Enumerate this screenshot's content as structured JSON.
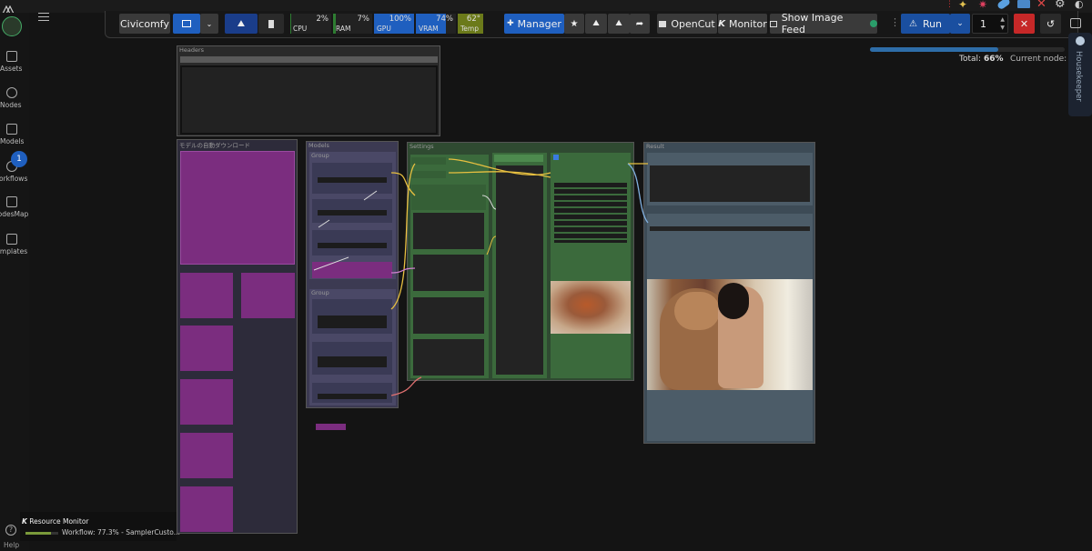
{
  "topbar": {
    "workspace_label": "Civicomfy",
    "meters": [
      {
        "name": "CPU",
        "value": "2%",
        "fill": 0.02,
        "color": "#2e7d32"
      },
      {
        "name": "RAM",
        "value": "7%",
        "fill": 0.07,
        "color": "#2e7d32"
      },
      {
        "name": "GPU",
        "value": "100%",
        "fill": 1.0,
        "color": "#1f5fbf"
      },
      {
        "name": "VRAM",
        "value": "74%",
        "fill": 0.74,
        "color": "#1f5fbf"
      },
      {
        "name": "Temp",
        "value": "62°",
        "fill": 1.0,
        "color": "#6b7a1a"
      }
    ],
    "manager_label": "Manager",
    "opencut_label": "OpenCut",
    "monitor_label": "Monitor",
    "image_feed_label": "Show Image Feed",
    "run_label": "Run",
    "run_count": "1"
  },
  "progress": {
    "total_label": "Total:",
    "total_value": "66%",
    "total_fraction": 0.66,
    "current_node_label": "Current node: –"
  },
  "sidebar": {
    "items": [
      {
        "label": "Assets"
      },
      {
        "label": "Nodes"
      },
      {
        "label": "Models"
      },
      {
        "label": "Workflows"
      },
      {
        "label": "NodesMap"
      },
      {
        "label": "Templates"
      }
    ],
    "workflows_badge": "1",
    "help_label": "Help"
  },
  "canvas": {
    "groups": {
      "headers": "Headers",
      "auto_download": "モデルの自動ダウンロード",
      "models": "Models",
      "settings": "Settings",
      "result": "Result",
      "sub_group_1": "Group",
      "sub_group_2": "Group"
    }
  },
  "resource_monitor": {
    "title": "Resource Monitor",
    "workflow_text": "Workflow: 77.3% - SamplerCusto...",
    "workflow_fraction": 0.773
  },
  "housekeeper": {
    "label": "Housekeeper"
  },
  "colors": {
    "accent_blue": "#1f5fbf",
    "run_blue": "#1a4fa0",
    "stop_red": "#c62828",
    "group_purple": "#7b2d7f",
    "group_green": "#355f36",
    "group_slate": "#3a3a55"
  }
}
